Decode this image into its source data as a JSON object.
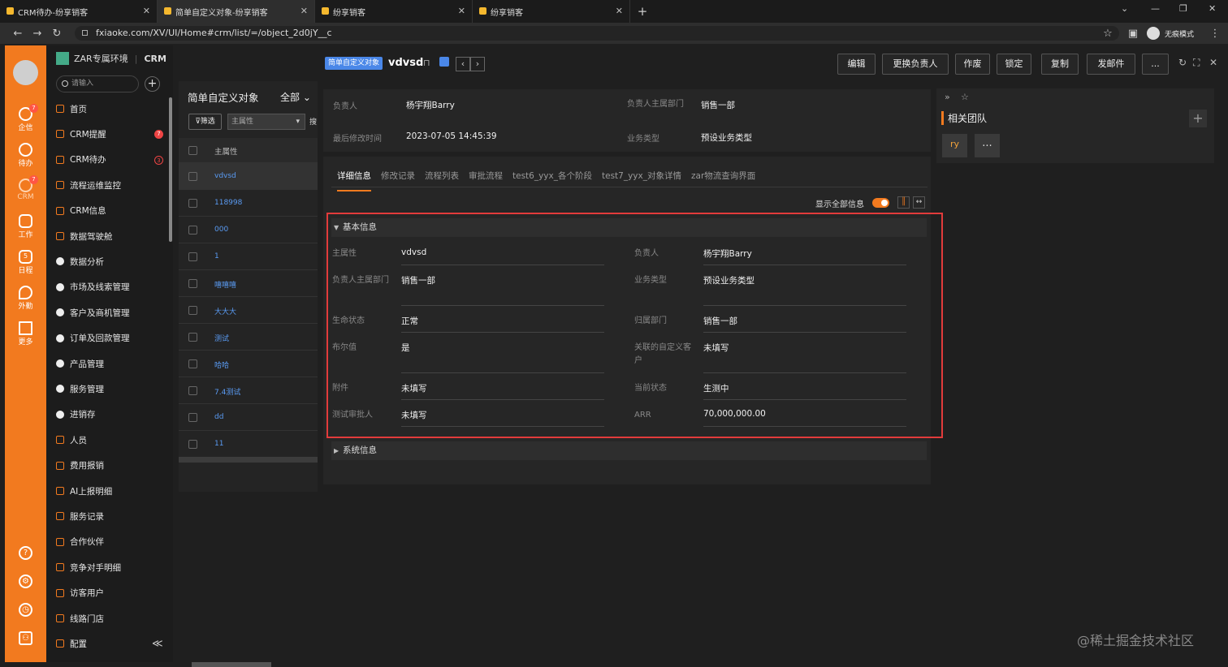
{
  "browser": {
    "tabs": [
      {
        "title": "CRM待办-纷享销客"
      },
      {
        "title": "简单自定义对象-纷享销客"
      },
      {
        "title": "纷享销客"
      },
      {
        "title": "纷享销客"
      }
    ],
    "url": "fxiaoke.com/XV/UI/Home#crm/list/=/object_2d0jY__c",
    "incognito_label": "无痕模式"
  },
  "leftbar": {
    "items": [
      {
        "label": "企信",
        "badge": "7"
      },
      {
        "label": "待办",
        "badge": ""
      },
      {
        "label": "CRM",
        "badge": "7"
      },
      {
        "label": "工作",
        "badge": ""
      },
      {
        "label": "日程",
        "badge": ""
      },
      {
        "label": "外勤",
        "badge": ""
      },
      {
        "label": "更多",
        "badge": ""
      }
    ],
    "calendar_day": "5"
  },
  "nav": {
    "env": "ZAR专属环境",
    "app": "CRM",
    "search_placeholder": "请输入",
    "items": [
      {
        "label": "首页",
        "badge": ""
      },
      {
        "label": "CRM提醒",
        "badge": "7"
      },
      {
        "label": "CRM待办",
        "badge": "3"
      },
      {
        "label": "流程运维监控",
        "badge": ""
      },
      {
        "label": "CRM信息",
        "badge": ""
      },
      {
        "label": "数据驾驶舱",
        "badge": ""
      },
      {
        "label": "数据分析",
        "badge": ""
      },
      {
        "label": "市场及线索管理",
        "badge": ""
      },
      {
        "label": "客户及商机管理",
        "badge": ""
      },
      {
        "label": "订单及回款管理",
        "badge": ""
      },
      {
        "label": "产品管理",
        "badge": ""
      },
      {
        "label": "服务管理",
        "badge": ""
      },
      {
        "label": "进销存",
        "badge": ""
      },
      {
        "label": "人员",
        "badge": ""
      },
      {
        "label": "费用报销",
        "badge": ""
      },
      {
        "label": "AI上报明细",
        "badge": ""
      },
      {
        "label": "服务记录",
        "badge": ""
      },
      {
        "label": "合作伙伴",
        "badge": ""
      },
      {
        "label": "竞争对手明细",
        "badge": ""
      },
      {
        "label": "访客用户",
        "badge": ""
      },
      {
        "label": "线路门店",
        "badge": ""
      },
      {
        "label": "配置",
        "badge": ""
      }
    ],
    "collapse": "≪"
  },
  "list": {
    "title": "简单自定义对象",
    "scope": "全部",
    "filter_label": "筛选",
    "field_select": "主属性",
    "search_label": "搜",
    "column": "主属性",
    "rows": [
      "vdvsd",
      "118998",
      "000",
      "1",
      "嘻嘻嘻",
      "大大大",
      "测试",
      "哈哈",
      "7.4测试",
      "dd",
      "11"
    ]
  },
  "detail": {
    "tag": "简单自定义对象",
    "title": "vdvsd",
    "actions": [
      "编辑",
      "更换负责人",
      "作废",
      "锁定",
      "复制",
      "发邮件",
      "..."
    ],
    "summary": [
      {
        "label": "负责人",
        "value": "杨宇翔Barry"
      },
      {
        "label": "负责人主属部门",
        "value": "销售一部"
      },
      {
        "label": "最后修改时间",
        "value": "2023-07-05 14:45:39"
      },
      {
        "label": "业务类型",
        "value": "预设业务类型"
      }
    ],
    "tabs": [
      "详细信息",
      "修改记录",
      "流程列表",
      "审批流程",
      "test6_yyx_各个阶段",
      "test7_yyx_对象详情",
      "zar物流查询界面"
    ],
    "show_all": "显示全部信息",
    "section_basic": "基本信息",
    "section_system": "系统信息",
    "fields": [
      {
        "label": "主属性",
        "value": "vdvsd"
      },
      {
        "label": "负责人",
        "value": "杨宇翔Barry"
      },
      {
        "label": "负责人主属部门",
        "value": "销售一部"
      },
      {
        "label": "业务类型",
        "value": "预设业务类型"
      },
      {
        "label": "生命状态",
        "value": "正常"
      },
      {
        "label": "归属部门",
        "value": "销售一部"
      },
      {
        "label": "布尔值",
        "value": "是"
      },
      {
        "label": "关联的自定义客户",
        "value": "未填写"
      },
      {
        "label": "附件",
        "value": "未填写"
      },
      {
        "label": "当前状态",
        "value": "生测中"
      },
      {
        "label": "测试审批人",
        "value": "未填写"
      },
      {
        "label": "ARR",
        "value": "70,000,000.00"
      }
    ]
  },
  "team": {
    "title": "相关团队",
    "avatar": "ry",
    "more": "..."
  },
  "watermark": "@稀土掘金技术社区",
  "colors": {
    "accent": "#f27a1f",
    "highlight": "#e23b3b",
    "link": "#5a9bf3"
  }
}
